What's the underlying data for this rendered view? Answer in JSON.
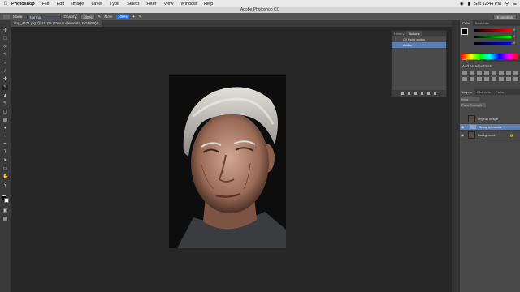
{
  "menubar": {
    "app_name": "Photoshop",
    "items": [
      "File",
      "Edit",
      "Image",
      "Layer",
      "Type",
      "Select",
      "Filter",
      "View",
      "Window",
      "Help"
    ],
    "clock": "Sat 12:44 PM"
  },
  "window_title": "Adobe Photoshop CC",
  "options": {
    "mode_label": "Mode:",
    "mode_value": "Normal",
    "opacity_label": "Opacity:",
    "opacity_value": "100%",
    "flow_label": "Flow:",
    "flow_value": "100%",
    "workspace": "Essentials"
  },
  "document_tab": "img_4571.jpg @ 16.7% (Group elements, RGB/8#) *",
  "actions_panel": {
    "tabs": [
      "History",
      "Actions"
    ],
    "rows": [
      {
        "label": "Oil Paint action",
        "selected": false
      },
      {
        "label": "Action",
        "selected": true
      }
    ]
  },
  "color_panel": {
    "tabs": [
      "Color",
      "Swatches"
    ],
    "slider_values": [
      "0",
      "0",
      "0"
    ]
  },
  "adjustments_panel": {
    "tabs": [
      "Adjustments",
      "Styles"
    ],
    "title": "Add an adjustment"
  },
  "layers_panel": {
    "tabs": [
      "Layers",
      "Channels",
      "Paths"
    ],
    "filter_label": "Kind",
    "blend_mode": "Pass Through",
    "layers": [
      {
        "name": "original image",
        "kind": "image",
        "selected": false
      },
      {
        "name": "Group elements",
        "kind": "group",
        "selected": true
      },
      {
        "name": "Background",
        "kind": "image",
        "selected": false
      }
    ]
  },
  "colors": {
    "ui_dark": "#262626",
    "panel": "#484848",
    "selection": "#5b7fb3",
    "accent_blue": "#2b6fd6"
  }
}
